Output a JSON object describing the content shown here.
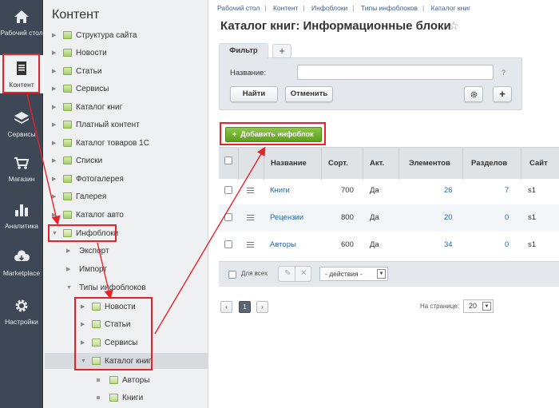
{
  "leftbar": {
    "items": [
      {
        "label": "Рабочий стол",
        "icon": "home-icon"
      },
      {
        "label": "Контент",
        "icon": "document-icon"
      },
      {
        "label": "Сервисы",
        "icon": "layers-icon"
      },
      {
        "label": "Магазин",
        "icon": "cart-icon"
      },
      {
        "label": "Аналитика",
        "icon": "bar-chart-icon"
      },
      {
        "label": "Marketplace",
        "icon": "cloud-download-icon"
      },
      {
        "label": "Настройки",
        "icon": "gear-icon"
      }
    ]
  },
  "tree": {
    "title": "Контент",
    "items": [
      {
        "label": "Структура сайта"
      },
      {
        "label": "Новости"
      },
      {
        "label": "Статьи"
      },
      {
        "label": "Сервисы"
      },
      {
        "label": "Каталог книг"
      },
      {
        "label": "Платный контент"
      },
      {
        "label": "Каталог товаров 1С"
      },
      {
        "label": "Списки"
      },
      {
        "label": "Фотогалерея"
      },
      {
        "label": "Галерея"
      },
      {
        "label": "Каталог авто"
      },
      {
        "label": "Инфоблоки"
      },
      {
        "label": "Экспорт"
      },
      {
        "label": "Импорт"
      },
      {
        "label": "Типы инфоблоков"
      },
      {
        "label": "Новости"
      },
      {
        "label": "Статьи"
      },
      {
        "label": "Сервисы"
      },
      {
        "label": "Каталог книг"
      },
      {
        "label": "Авторы"
      },
      {
        "label": "Книги"
      }
    ]
  },
  "breadcrumbs": [
    "Рабочий стол",
    "Контент",
    "Инфоблоки",
    "Типы инфоблоков",
    "Каталог книг"
  ],
  "page_title": "Каталог книг: Информационные блоки",
  "filter": {
    "tab_label": "Фильтр",
    "add_tab": "+",
    "name_label": "Название:",
    "name_value": "",
    "help": "?",
    "find_button": "Найти",
    "cancel_button": "Отменить",
    "plus_button": "+"
  },
  "add_button": "Добавить инфоблок",
  "table": {
    "headers": [
      "Название",
      "Сорт.",
      "Акт.",
      "Элементов",
      "Разделов",
      "Сайт"
    ],
    "rows": [
      {
        "name": "Книги",
        "sort": "700",
        "active": "Да",
        "elements": "26",
        "sections": "7",
        "site": "s1"
      },
      {
        "name": "Рецензии",
        "sort": "800",
        "active": "Да",
        "elements": "20",
        "sections": "0",
        "site": "s1"
      },
      {
        "name": "Авторы",
        "sort": "600",
        "active": "Да",
        "elements": "34",
        "sections": "0",
        "site": "s1"
      }
    ],
    "footer": {
      "for_all": "Для всех",
      "actions": "- действия -"
    }
  },
  "pager": {
    "prev": "‹",
    "page": "1",
    "next": "›",
    "per_page_label": "На странице:",
    "per_page_value": "20"
  },
  "colors": {
    "annotation": "#e8222a",
    "add_button": "#6aaa2a",
    "dark_menu": "#3d4755"
  }
}
